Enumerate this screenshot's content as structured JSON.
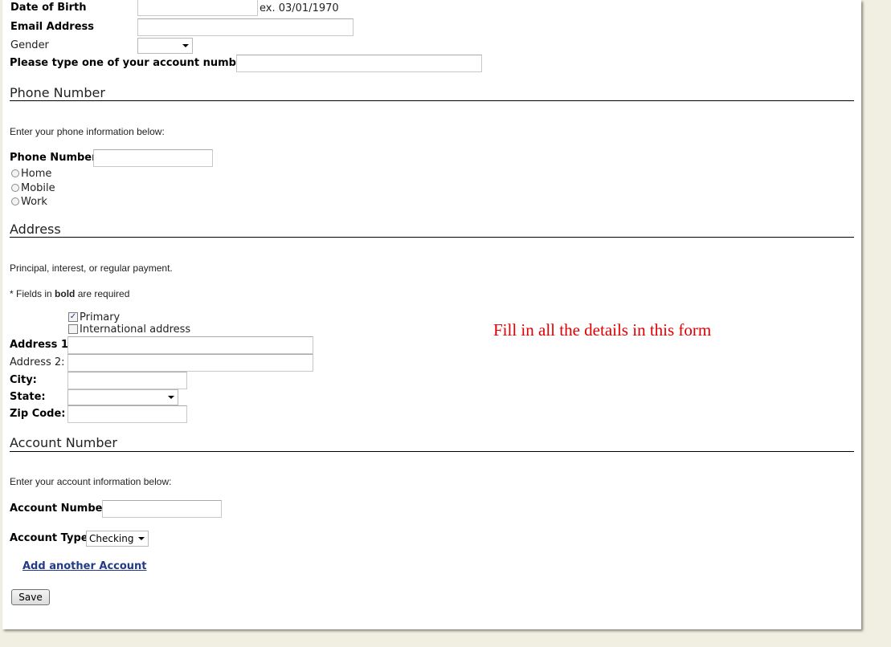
{
  "personal": {
    "dob_label": "Date of Birth",
    "dob_hint": "ex. 03/01/1970",
    "email_label": "Email Address",
    "gender_label": "Gender",
    "gender_value": "",
    "account_num_prompt": "Please type one of your account numbers."
  },
  "phone": {
    "section_title": "Phone Number",
    "intro": "Enter your phone information below:",
    "label": "Phone Number",
    "options": [
      "Home",
      "Mobile",
      "Work"
    ]
  },
  "address": {
    "section_title": "Address",
    "intro": "Principal, interest, or regular payment.",
    "required_prefix": "* Fields in ",
    "required_bold": "bold",
    "required_suffix": " are required",
    "primary_label": "Primary",
    "primary_checked": true,
    "international_label": "International address",
    "international_checked": false,
    "address1_label": "Address 1:",
    "address2_label": "Address 2:",
    "city_label": "City:",
    "state_label": "State:",
    "state_value": "",
    "zip_label": "Zip Code:"
  },
  "account": {
    "section_title": "Account Number",
    "intro": "Enter your account information below:",
    "number_label": "Account Number",
    "type_label": "Account Type",
    "type_value": "Checking",
    "add_link": "Add another Account",
    "save_button": "Save"
  },
  "annotation": "Fill in all the details in this form"
}
